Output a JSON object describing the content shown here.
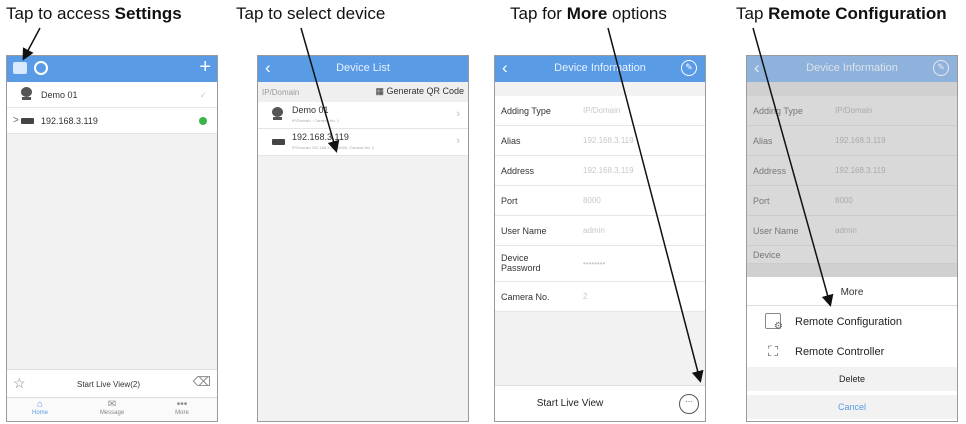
{
  "captions": {
    "c1_pre": "Tap to access ",
    "c1_bold": "Settings",
    "c2": "Tap to select device",
    "c3_pre": "Tap for ",
    "c3_bold": "More",
    "c3_post": " options",
    "c4_pre": "Tap ",
    "c4_bold": "Remote Configuration"
  },
  "screen1": {
    "devices": [
      {
        "label": "Demo 01",
        "icon": "camera-icon"
      },
      {
        "label": "192.168.3.119",
        "icon": "dvr-icon",
        "status_color": "#3db44a"
      }
    ],
    "start_live": "Start Live View(2)",
    "tabs": [
      {
        "label": "Home",
        "icon": "home-icon"
      },
      {
        "label": "Message",
        "icon": "message-icon"
      },
      {
        "label": "More",
        "icon": "more-dots-icon"
      }
    ]
  },
  "screen2": {
    "title": "Device List",
    "section": "IP/Domain",
    "qr_label": "Generate QR Code",
    "devices": [
      {
        "name": "Demo 01",
        "detail": "IP/Domain  ·  Camera No. 1"
      },
      {
        "name": "192.168.3.119",
        "detail": "IP/Domain  192.168.3.119:8000, Camera No. 2"
      }
    ]
  },
  "screen3": {
    "title": "Device Information",
    "fields": [
      {
        "key": "Adding Type",
        "value": "IP/Domain"
      },
      {
        "key": "Alias",
        "value": "192.168.3.119"
      },
      {
        "key": "Address",
        "value": "192.168.3.119"
      },
      {
        "key": "Port",
        "value": "8000"
      },
      {
        "key": "User Name",
        "value": "admin"
      },
      {
        "key": "Device Password",
        "value": "••••••••"
      },
      {
        "key": "Camera No.",
        "value": "2"
      }
    ],
    "start_live": "Start Live View",
    "more_glyph": "···"
  },
  "screen4": {
    "title": "Device Information",
    "fields": [
      {
        "key": "Adding Type",
        "value": "IP/Domain"
      },
      {
        "key": "Alias",
        "value": "192.168.3.119"
      },
      {
        "key": "Address",
        "value": "192.168.3.119"
      },
      {
        "key": "Port",
        "value": "8000"
      },
      {
        "key": "User Name",
        "value": "admin"
      },
      {
        "key": "Device",
        "value": ""
      }
    ],
    "sheet_title": "More",
    "options": [
      "Remote Configuration",
      "Remote Controller"
    ],
    "delete": "Delete",
    "cancel": "Cancel"
  }
}
